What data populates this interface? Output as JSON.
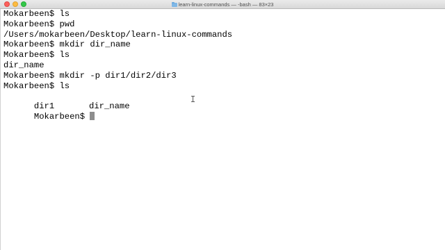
{
  "window": {
    "title": "learn-linux-commands — -bash — 83×23"
  },
  "terminal": {
    "lines": [
      "Mokarbeen$ ls",
      "Mokarbeen$ pwd",
      "/Users/mokarbeen/Desktop/learn-linux-commands",
      "Mokarbeen$ mkdir dir_name",
      "Mokarbeen$ ls",
      "dir_name",
      "Mokarbeen$ mkdir -p dir1/dir2/dir3",
      "Mokarbeen$ ls"
    ],
    "ls_output": [
      "dir1",
      "dir_name"
    ],
    "prompt": "Mokarbeen$ "
  },
  "colors": {
    "background": "#ffffff",
    "text": "#000000",
    "cursor": "#8e8e8e"
  },
  "icons": {
    "title_icon": "folder-icon",
    "cursor": "block-cursor",
    "pointer": "ibeam-cursor-icon"
  }
}
